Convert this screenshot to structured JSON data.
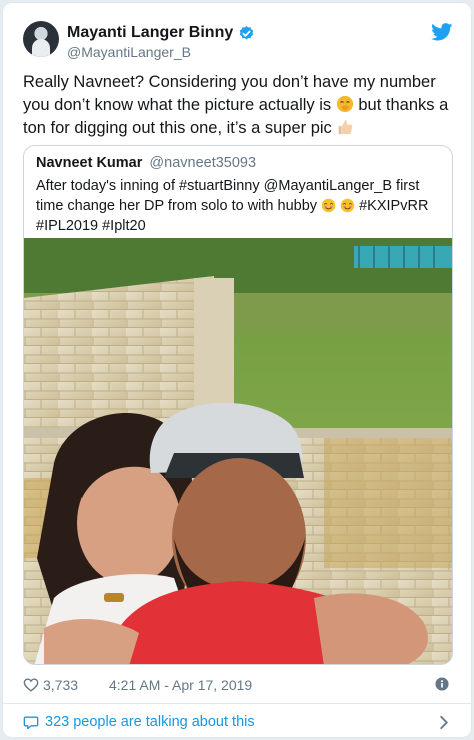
{
  "tweet": {
    "author": {
      "name": "Mayanti Langer Binny",
      "handle": "@MayantiLanger_B"
    },
    "text_part1": "Really Navneet? Considering you don’t have my number you don’t know what the picture actually is",
    "text_part2": "but thanks a ton for digging out this one, it’s a super pic",
    "icons": [
      "verified-badge",
      "twitter-bird",
      "face-with-hand-over-mouth-emoji",
      "thumbs-up-emoji"
    ]
  },
  "quote": {
    "author": {
      "name": "Navneet Kumar",
      "handle": "@navneet35093"
    },
    "text_part1": "After today's inning of #stuartBinny @MayantiLanger_B  first time change her DP from solo to with hubby",
    "text_part2": "#KXIPvRR #IPL2019 #Iplt20",
    "icons": [
      "smiling-face-emoji",
      "smiling-face-emoji"
    ]
  },
  "footer": {
    "likes": "3,733",
    "timestamp": "4:21 AM - Apr 17, 2019",
    "talking": "323 people are talking about this",
    "icons": [
      "heart",
      "info",
      "speech-bubble",
      "chevron-right"
    ]
  },
  "colors": {
    "blue": "#1da1f2",
    "link": "#1b95e0",
    "grey": "#657786",
    "border": "#e1e8ed"
  }
}
